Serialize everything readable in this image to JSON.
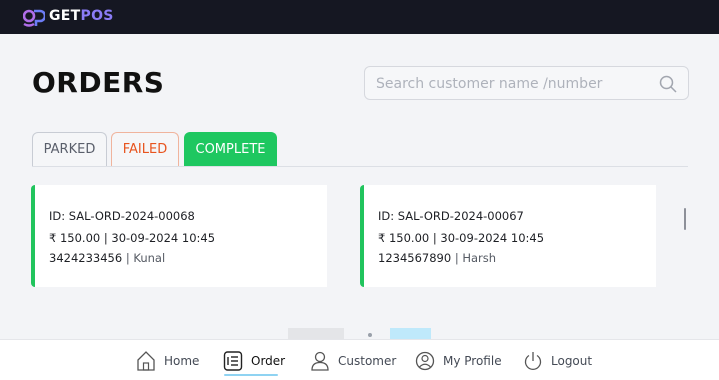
{
  "header": {
    "logo_mark": "gp",
    "brand_get": "GET",
    "brand_pos": "POS"
  },
  "page": {
    "title": "ORDERS"
  },
  "search": {
    "placeholder": "Search customer name /number"
  },
  "tabs": [
    {
      "label": "PARKED",
      "active": false
    },
    {
      "label": "FAILED",
      "active": false
    },
    {
      "label": "COMPLETE",
      "active": true
    }
  ],
  "orders": [
    {
      "id": "ID: SAL-ORD-2024-00068",
      "amount_date": "₹ 150.00 | 30-09-2024 10:45",
      "phone": "3424233456",
      "separator": " | ",
      "name": "Kunal"
    },
    {
      "id": "ID: SAL-ORD-2024-00067",
      "amount_date": "₹ 150.00 | 30-09-2024 10:45",
      "phone": "1234567890",
      "separator": " | ",
      "name": "Harsh"
    }
  ],
  "bottom_nav": [
    {
      "label": "Home",
      "icon": "home-icon"
    },
    {
      "label": "Order",
      "icon": "order-list-icon",
      "active": true
    },
    {
      "label": "Customer",
      "icon": "user-icon"
    },
    {
      "label": "My Profile",
      "icon": "profile-icon"
    },
    {
      "label": "Logout",
      "icon": "power-icon"
    }
  ],
  "colors": {
    "header_bg": "#151722",
    "accent_green": "#1ec760",
    "failed_orange": "#e8541e",
    "brand_purple": "#8b7cf6"
  }
}
